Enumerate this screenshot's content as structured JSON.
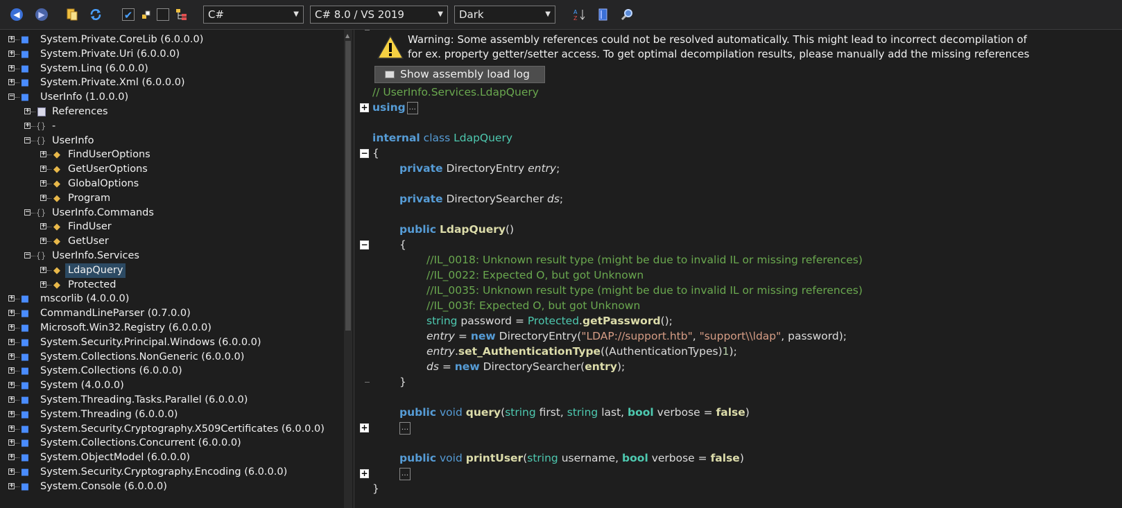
{
  "toolbar": {
    "back_icon": "arrow-left-icon",
    "forward_icon": "arrow-right-icon",
    "language": "C#",
    "version": "C# 8.0 / VS 2019",
    "theme": "Dark"
  },
  "tree": {
    "items": [
      {
        "label": "System.Private.CoreLib (6.0.0.0)",
        "icon": "assembly-icon",
        "depth": 0,
        "exp": "+"
      },
      {
        "label": "System.Private.Uri (6.0.0.0)",
        "icon": "assembly-icon",
        "depth": 0,
        "exp": "+"
      },
      {
        "label": "System.Linq (6.0.0.0)",
        "icon": "assembly-icon",
        "depth": 0,
        "exp": "+"
      },
      {
        "label": "System.Private.Xml (6.0.0.0)",
        "icon": "assembly-icon",
        "depth": 0,
        "exp": "+"
      },
      {
        "label": "UserInfo (1.0.0.0)",
        "icon": "assembly-icon",
        "depth": 0,
        "exp": "-"
      },
      {
        "label": "References",
        "icon": "references-icon",
        "depth": 1,
        "exp": "+"
      },
      {
        "label": "-",
        "icon": "namespace-icon",
        "depth": 1,
        "exp": "+"
      },
      {
        "label": "UserInfo",
        "icon": "namespace-icon",
        "depth": 1,
        "exp": "-"
      },
      {
        "label": "FindUserOptions",
        "icon": "class-icon",
        "depth": 2,
        "exp": "+"
      },
      {
        "label": "GetUserOptions",
        "icon": "class-icon",
        "depth": 2,
        "exp": "+"
      },
      {
        "label": "GlobalOptions",
        "icon": "class-icon",
        "depth": 2,
        "exp": "+"
      },
      {
        "label": "Program",
        "icon": "class-icon",
        "depth": 2,
        "exp": "+"
      },
      {
        "label": "UserInfo.Commands",
        "icon": "namespace-icon",
        "depth": 1,
        "exp": "-"
      },
      {
        "label": "FindUser",
        "icon": "class-icon",
        "depth": 2,
        "exp": "+"
      },
      {
        "label": "GetUser",
        "icon": "class-icon",
        "depth": 2,
        "exp": "+"
      },
      {
        "label": "UserInfo.Services",
        "icon": "namespace-icon",
        "depth": 1,
        "exp": "-"
      },
      {
        "label": "LdapQuery",
        "icon": "class-icon",
        "depth": 2,
        "exp": "+",
        "selected": true
      },
      {
        "label": "Protected",
        "icon": "class-icon",
        "depth": 2,
        "exp": "+"
      },
      {
        "label": "mscorlib (4.0.0.0)",
        "icon": "assembly-icon",
        "depth": 0,
        "exp": "+"
      },
      {
        "label": "CommandLineParser (0.7.0.0)",
        "icon": "assembly-icon",
        "depth": 0,
        "exp": "+"
      },
      {
        "label": "Microsoft.Win32.Registry (6.0.0.0)",
        "icon": "assembly-icon",
        "depth": 0,
        "exp": "+"
      },
      {
        "label": "System.Security.Principal.Windows (6.0.0.0)",
        "icon": "assembly-icon",
        "depth": 0,
        "exp": "+"
      },
      {
        "label": "System.Collections.NonGeneric (6.0.0.0)",
        "icon": "assembly-icon",
        "depth": 0,
        "exp": "+"
      },
      {
        "label": "System.Collections (6.0.0.0)",
        "icon": "assembly-icon",
        "depth": 0,
        "exp": "+"
      },
      {
        "label": "System (4.0.0.0)",
        "icon": "assembly-icon",
        "depth": 0,
        "exp": "+"
      },
      {
        "label": "System.Threading.Tasks.Parallel (6.0.0.0)",
        "icon": "assembly-icon",
        "depth": 0,
        "exp": "+"
      },
      {
        "label": "System.Threading (6.0.0.0)",
        "icon": "assembly-icon",
        "depth": 0,
        "exp": "+"
      },
      {
        "label": "System.Security.Cryptography.X509Certificates (6.0.0.0)",
        "icon": "assembly-icon",
        "depth": 0,
        "exp": "+"
      },
      {
        "label": "System.Collections.Concurrent (6.0.0.0)",
        "icon": "assembly-icon",
        "depth": 0,
        "exp": "+"
      },
      {
        "label": "System.ObjectModel (6.0.0.0)",
        "icon": "assembly-icon",
        "depth": 0,
        "exp": "+"
      },
      {
        "label": "System.Security.Cryptography.Encoding (6.0.0.0)",
        "icon": "assembly-icon",
        "depth": 0,
        "exp": "+"
      },
      {
        "label": "System.Console (6.0.0.0)",
        "icon": "assembly-icon",
        "depth": 0,
        "exp": "+"
      }
    ]
  },
  "warning": {
    "line1": "Warning: Some assembly references could not be resolved automatically. This might lead to incorrect decompilation of",
    "line2": "for ex. property getter/setter access. To get optimal decompilation results, please manually add the missing references",
    "button": "Show assembly load log"
  },
  "code": {
    "lines": [
      {
        "indent": 0,
        "tokens": [
          {
            "t": "// UserInfo.Services.LdapQuery",
            "c": "cmt"
          }
        ]
      },
      {
        "indent": 0,
        "tokens": [
          {
            "t": "using",
            "c": "kwb"
          }
        ],
        "ellipsis": true
      },
      {
        "indent": 0,
        "tokens": []
      },
      {
        "indent": 0,
        "tokens": [
          {
            "t": "internal",
            "c": "kwb"
          },
          {
            "t": " "
          },
          {
            "t": "class",
            "c": "kw"
          },
          {
            "t": " "
          },
          {
            "t": "LdapQuery",
            "c": "typ"
          }
        ]
      },
      {
        "indent": 0,
        "tokens": [
          {
            "t": "{"
          }
        ]
      },
      {
        "indent": 1,
        "tokens": [
          {
            "t": "private",
            "c": "kwb"
          },
          {
            "t": " DirectoryEntry "
          },
          {
            "t": "entry",
            "c": "it"
          },
          {
            "t": ";"
          }
        ]
      },
      {
        "indent": 0,
        "tokens": []
      },
      {
        "indent": 1,
        "tokens": [
          {
            "t": "private",
            "c": "kwb"
          },
          {
            "t": " DirectorySearcher "
          },
          {
            "t": "ds",
            "c": "it"
          },
          {
            "t": ";"
          }
        ]
      },
      {
        "indent": 0,
        "tokens": []
      },
      {
        "indent": 1,
        "tokens": [
          {
            "t": "public",
            "c": "kwb"
          },
          {
            "t": " "
          },
          {
            "t": "LdapQuery",
            "c": "mth"
          },
          {
            "t": "()"
          }
        ]
      },
      {
        "indent": 1,
        "tokens": [
          {
            "t": "{"
          }
        ]
      },
      {
        "indent": 2,
        "tokens": [
          {
            "t": "//IL_0018: Unknown result type (might be due to invalid IL or missing references)",
            "c": "cmt"
          }
        ]
      },
      {
        "indent": 2,
        "tokens": [
          {
            "t": "//IL_0022: Expected O, but got Unknown",
            "c": "cmt"
          }
        ]
      },
      {
        "indent": 2,
        "tokens": [
          {
            "t": "//IL_0035: Unknown result type (might be due to invalid IL or missing references)",
            "c": "cmt"
          }
        ]
      },
      {
        "indent": 2,
        "tokens": [
          {
            "t": "//IL_003f: Expected O, but got Unknown",
            "c": "cmt"
          }
        ]
      },
      {
        "indent": 2,
        "tokens": [
          {
            "t": "string",
            "c": "typ"
          },
          {
            "t": " password = "
          },
          {
            "t": "Protected",
            "c": "typ"
          },
          {
            "t": "."
          },
          {
            "t": "getPassword",
            "c": "mth"
          },
          {
            "t": "();"
          }
        ]
      },
      {
        "indent": 2,
        "tokens": [
          {
            "t": "entry",
            "c": "it"
          },
          {
            "t": " = "
          },
          {
            "t": "new",
            "c": "kwb"
          },
          {
            "t": " DirectoryEntry("
          },
          {
            "t": "\"LDAP://support.htb\"",
            "c": "str"
          },
          {
            "t": ", "
          },
          {
            "t": "\"support\\\\ldap\"",
            "c": "str"
          },
          {
            "t": ", password);"
          }
        ]
      },
      {
        "indent": 2,
        "tokens": [
          {
            "t": "entry",
            "c": "it"
          },
          {
            "t": "."
          },
          {
            "t": "set_AuthenticationType",
            "c": "mth"
          },
          {
            "t": "((AuthenticationTypes)"
          },
          {
            "t": "1",
            "c": "num"
          },
          {
            "t": ");"
          }
        ]
      },
      {
        "indent": 2,
        "tokens": [
          {
            "t": "ds",
            "c": "it"
          },
          {
            "t": " = "
          },
          {
            "t": "new",
            "c": "kwb"
          },
          {
            "t": " DirectorySearcher("
          },
          {
            "t": "entry",
            "c": "mth"
          },
          {
            "t": ");"
          }
        ]
      },
      {
        "indent": 1,
        "tokens": [
          {
            "t": "}"
          }
        ]
      },
      {
        "indent": 0,
        "tokens": []
      },
      {
        "indent": 1,
        "tokens": [
          {
            "t": "public",
            "c": "kwb"
          },
          {
            "t": " "
          },
          {
            "t": "void",
            "c": "kw"
          },
          {
            "t": " "
          },
          {
            "t": "query",
            "c": "mth"
          },
          {
            "t": "("
          },
          {
            "t": "string",
            "c": "typ"
          },
          {
            "t": " first, "
          },
          {
            "t": "string",
            "c": "typ"
          },
          {
            "t": " last, "
          },
          {
            "t": "bool",
            "c": "tyb"
          },
          {
            "t": " verbose = "
          },
          {
            "t": "false",
            "c": "mth"
          },
          {
            "t": ")"
          }
        ]
      },
      {
        "indent": 1,
        "tokens": [],
        "ellipsis": true
      },
      {
        "indent": 0,
        "tokens": []
      },
      {
        "indent": 1,
        "tokens": [
          {
            "t": "public",
            "c": "kwb"
          },
          {
            "t": " "
          },
          {
            "t": "void",
            "c": "kw"
          },
          {
            "t": " "
          },
          {
            "t": "printUser",
            "c": "mth"
          },
          {
            "t": "("
          },
          {
            "t": "string",
            "c": "typ"
          },
          {
            "t": " username, "
          },
          {
            "t": "bool",
            "c": "tyb"
          },
          {
            "t": " verbose = "
          },
          {
            "t": "false",
            "c": "mth"
          },
          {
            "t": ")"
          }
        ]
      },
      {
        "indent": 1,
        "tokens": [],
        "ellipsis": true
      },
      {
        "indent": 0,
        "tokens": [
          {
            "t": "}"
          }
        ]
      }
    ]
  }
}
